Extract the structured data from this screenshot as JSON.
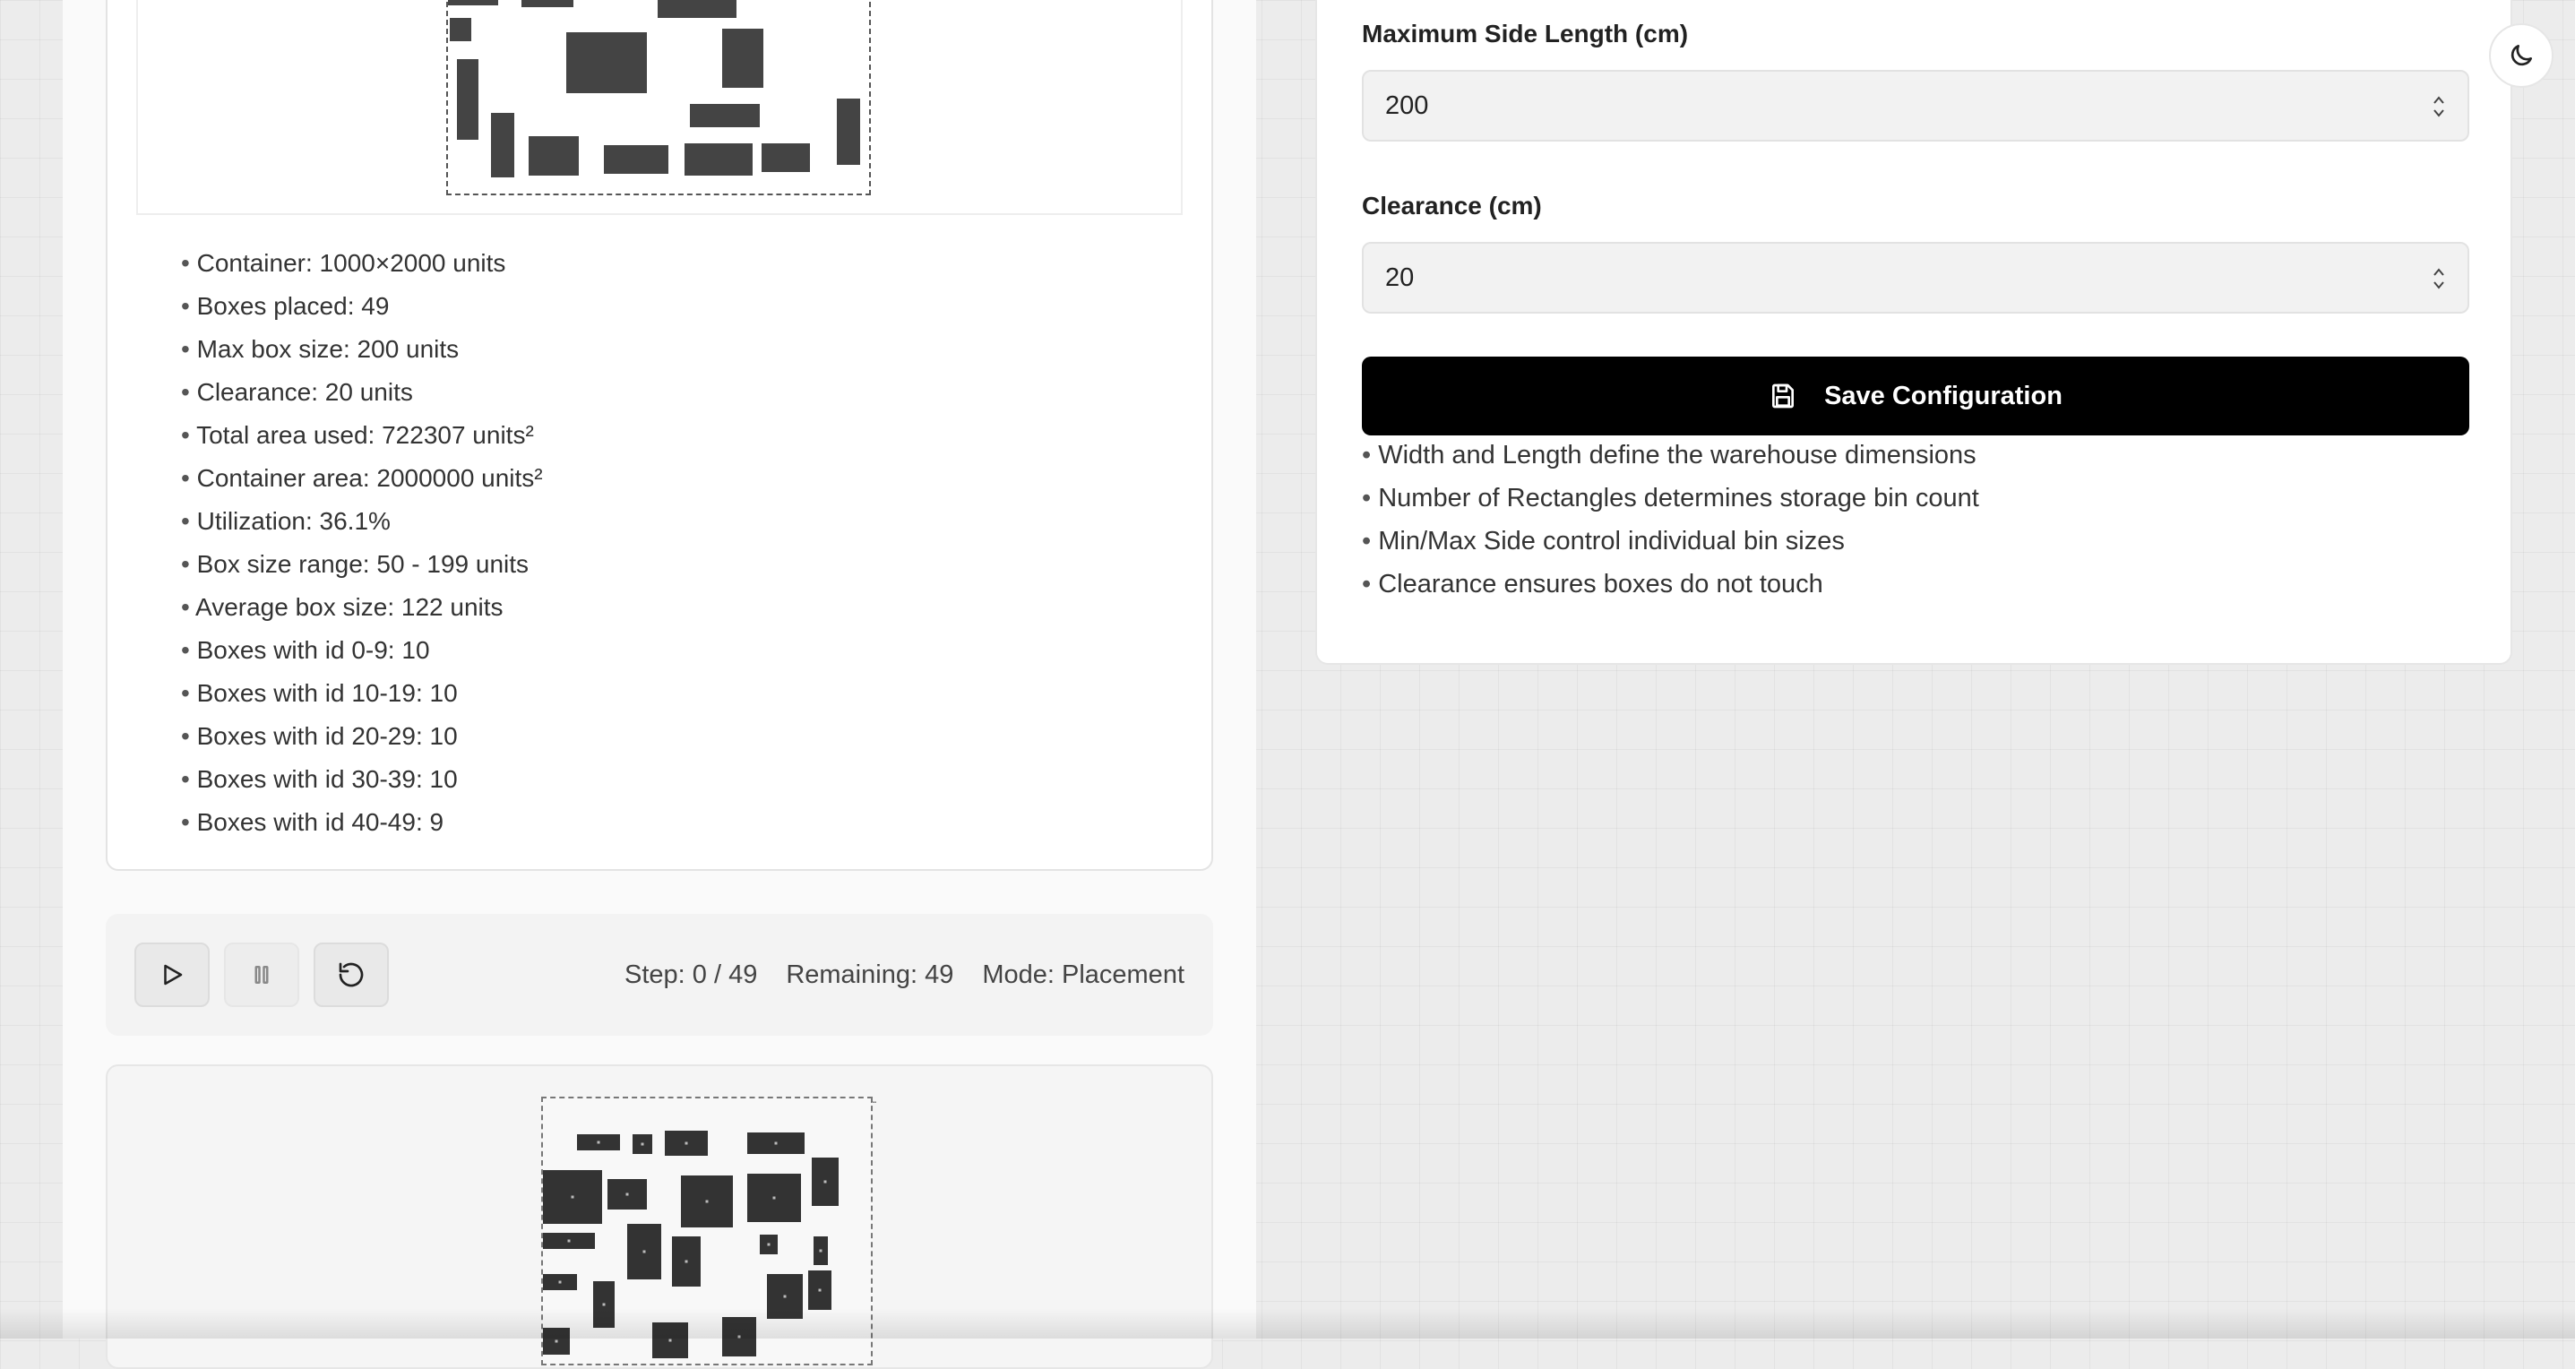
{
  "stats": {
    "container": "Container: 1000×2000 units",
    "boxes_placed": "Boxes placed: 49",
    "max_box_size": "Max box size: 200 units",
    "clearance": "Clearance: 20 units",
    "total_area": "Total area used: 722307 units²",
    "container_area": "Container area: 2000000 units²",
    "utilization": "Utilization: 36.1%",
    "size_range": "Box size range: 50 - 199 units",
    "average_size": "Average box size: 122 units",
    "ids_0_9": "Boxes with id 0-9: 10",
    "ids_10_19": "Boxes with id 10-19: 10",
    "ids_20_29": "Boxes with id 20-29: 10",
    "ids_30_39": "Boxes with id 30-39: 10",
    "ids_40_49": "Boxes with id 40-49: 9"
  },
  "controls": {
    "play_icon": "play-icon",
    "pause_icon": "pause-icon",
    "reset_icon": "reset-icon",
    "step": "Step: 0 / 49",
    "remaining": "Remaining: 49",
    "mode": "Mode: Placement"
  },
  "form": {
    "max_side_label": "Maximum Side Length (cm)",
    "max_side_value": "200",
    "clearance_label": "Clearance (cm)",
    "clearance_value": "20",
    "save_label": "Save Configuration",
    "save_icon": "save-icon"
  },
  "help": [
    "Width and Length define the warehouse dimensions",
    "Number of Rectangles determines storage bin count",
    "Min/Max Side control individual bin sizes",
    "Clearance ensures boxes do not touch"
  ],
  "theme_toggle_icon": "moon-icon",
  "colors": {
    "primary_button": "#000000",
    "box_fill": "#444444",
    "page_background": "#ececec"
  }
}
